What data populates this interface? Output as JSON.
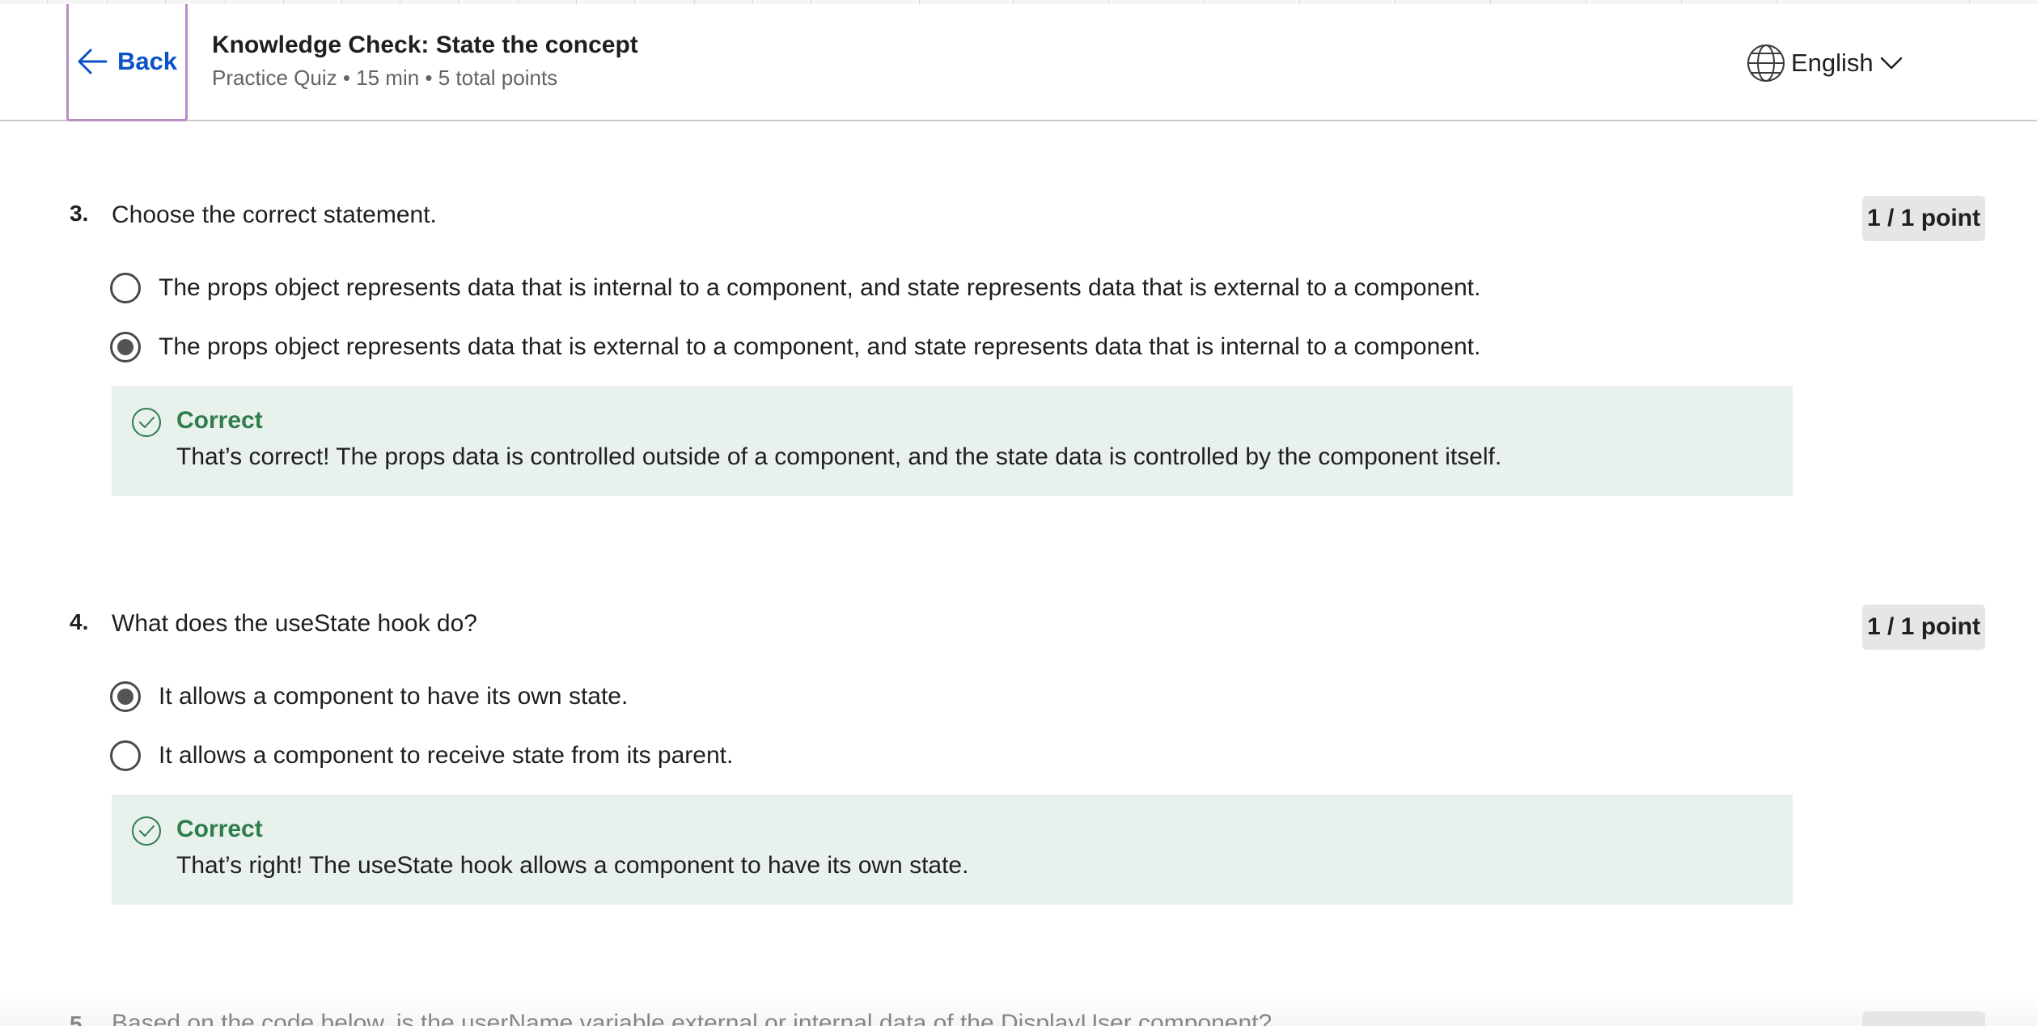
{
  "header": {
    "back_label": "Back",
    "title": "Knowledge Check: State the concept",
    "subtitle": "Practice Quiz • 15 min • 5 total points",
    "language": "English"
  },
  "questions": [
    {
      "number": "3.",
      "text": "Choose the correct statement.",
      "points": "1 / 1 point",
      "options": [
        {
          "label": "The props object represents data that is internal to a component, and state represents data that is external to a component.",
          "selected": false
        },
        {
          "label": "The props object represents data that is external to a component, and state represents data that is internal to a component.",
          "selected": true
        }
      ],
      "feedback": {
        "status": "Correct",
        "text": "That’s correct! The props data is controlled outside of a component, and the state data is controlled by the component itself."
      }
    },
    {
      "number": "4.",
      "text": "What does the useState hook do?",
      "points": "1 / 1 point",
      "options": [
        {
          "label": "It allows a component to have its own state.",
          "selected": true
        },
        {
          "label": "It allows a component to receive state from its parent.",
          "selected": false
        }
      ],
      "feedback": {
        "status": "Correct",
        "text": "That’s right! The useState hook allows a component to have its own state."
      }
    }
  ],
  "next_question_peek": {
    "number": "5.",
    "text": "Based on the code below, is the userName variable external or internal data of the DisplayUser component?"
  },
  "colors": {
    "accent": "#0b52c6",
    "correct": "#2f7d4c",
    "feedback_bg": "#e8f1ec",
    "focus_outline": "#b98ec4"
  },
  "icons": {
    "back": "arrow-left-icon",
    "language": "globe-icon",
    "dropdown": "chevron-down-icon",
    "feedback": "check-circle-icon"
  }
}
